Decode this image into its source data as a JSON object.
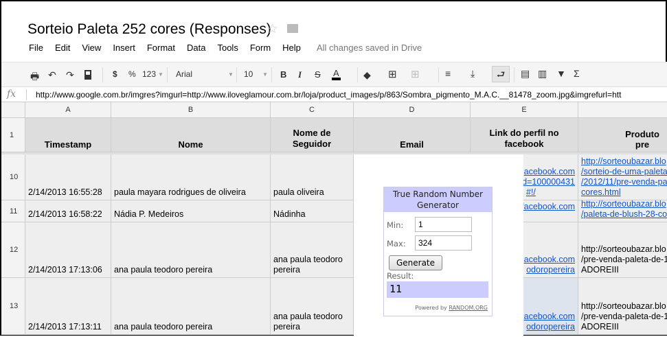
{
  "doc": {
    "title": "Sorteio Paleta 252 cores (Responses)",
    "status": "All changes saved in Drive"
  },
  "menu": [
    "File",
    "Edit",
    "View",
    "Insert",
    "Format",
    "Data",
    "Tools",
    "Form",
    "Help"
  ],
  "toolbar": {
    "currency": "$",
    "percent": "%",
    "number_format": "123",
    "font": "Arial",
    "font_size": "10",
    "bold": "B",
    "italic": "I",
    "strike": "S",
    "text_color": "A",
    "sum": "Σ"
  },
  "formula": {
    "icon": "fx",
    "value": "http://www.google.com.br/imgres?imgurl=http://www.iloveglamour.com.br/loja/product_images/p/863/Sombra_pigmento_M.A.C.__81478_zoom.jpg&imgrefurl=htt"
  },
  "columns": [
    "A",
    "B",
    "C",
    "D",
    "E"
  ],
  "headers": [
    "Timestamp",
    "Nome",
    "Nome de Seguidor",
    "Email",
    "Link do perfil no facebook",
    "Produto pre"
  ],
  "rows": [
    {
      "num": "10",
      "a": "2/14/2013 16:55:28",
      "b": "paula mayara rodrigues de oliveira",
      "c": "paula oliveira",
      "e": [
        "acebook.com",
        "d=100000431",
        "#!/"
      ],
      "f": [
        "http://sorteoubazar.blo",
        "/sorteio-de-uma-paleta",
        "/2012/11/pre-venda-pa",
        "cores.html"
      ]
    },
    {
      "num": "11",
      "a": "2/14/2013 16:58:22",
      "b": "Nádia P. Medeiros",
      "c": "Nádinha",
      "e": [
        "facebook.com"
      ],
      "f": [
        "http://sorteoubazar.blo",
        "/paleta-de-blush-28-co"
      ]
    },
    {
      "num": "12",
      "a": "2/14/2013 17:13:06",
      "b": "ana paula teodoro pereira",
      "c": [
        "ana paula teodoro",
        "pereira"
      ],
      "e": [
        "acebook.com",
        "odoropereira"
      ],
      "f": [
        "http://sorteoubazar.blo",
        "/pre-venda-paleta-de-1",
        "ADOREIII"
      ]
    },
    {
      "num": "13",
      "a": "2/14/2013 17:13:11",
      "b": "ana paula teodoro pereira",
      "c": [
        "ana paula teodoro",
        "pereira"
      ],
      "e": [
        "acebook.com",
        "odoropereira"
      ],
      "f": [
        "http://sorteoubazar.blo",
        "/pre-venda-paleta-de-1",
        "ADOREIII"
      ]
    }
  ],
  "rng": {
    "title1": "True Random Number",
    "title2": "Generator",
    "min_label": "Min:",
    "min": "1",
    "max_label": "Max:",
    "max": "324",
    "button": "Generate",
    "result_label": "Result:",
    "result": "11",
    "powered": "Powered by",
    "powered_link": "RANDOM.ORG"
  }
}
